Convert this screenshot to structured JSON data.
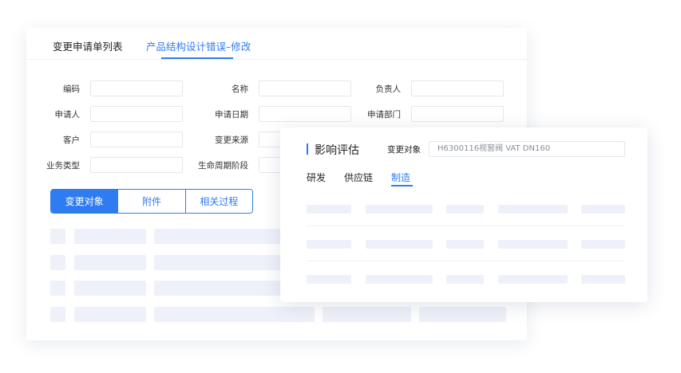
{
  "list_card": {
    "tabs": [
      {
        "label": "变更申请单列表"
      },
      {
        "label": "产品结构设计错误–修改"
      }
    ],
    "form": {
      "fields": [
        {
          "label": "编码",
          "value": ""
        },
        {
          "label": "名称",
          "value": ""
        },
        {
          "label": "负责人",
          "value": ""
        },
        {
          "label": "申请人",
          "value": ""
        },
        {
          "label": "申请日期",
          "value": ""
        },
        {
          "label": "申请部门",
          "value": ""
        },
        {
          "label": "客户",
          "value": ""
        },
        {
          "label": "变更来源",
          "value": ""
        },
        {
          "label": "业务类型",
          "value": ""
        },
        {
          "label": "生命周期阶段",
          "value": ""
        }
      ]
    },
    "segments": [
      {
        "label": "变更对象",
        "active": true
      },
      {
        "label": "附件",
        "active": false
      },
      {
        "label": "相关过程",
        "active": false
      }
    ]
  },
  "impact_panel": {
    "title": "影响评估",
    "object_label": "变更对象",
    "object_value": "H6300116视窗阀 VAT DN160",
    "tabs": [
      {
        "label": "研发",
        "active": false
      },
      {
        "label": "供应链",
        "active": false
      },
      {
        "label": "制造",
        "active": true
      }
    ]
  },
  "colors": {
    "accent": "#2f7cf0",
    "placeholder": "#eef1f9",
    "border": "#e4e7ec"
  }
}
